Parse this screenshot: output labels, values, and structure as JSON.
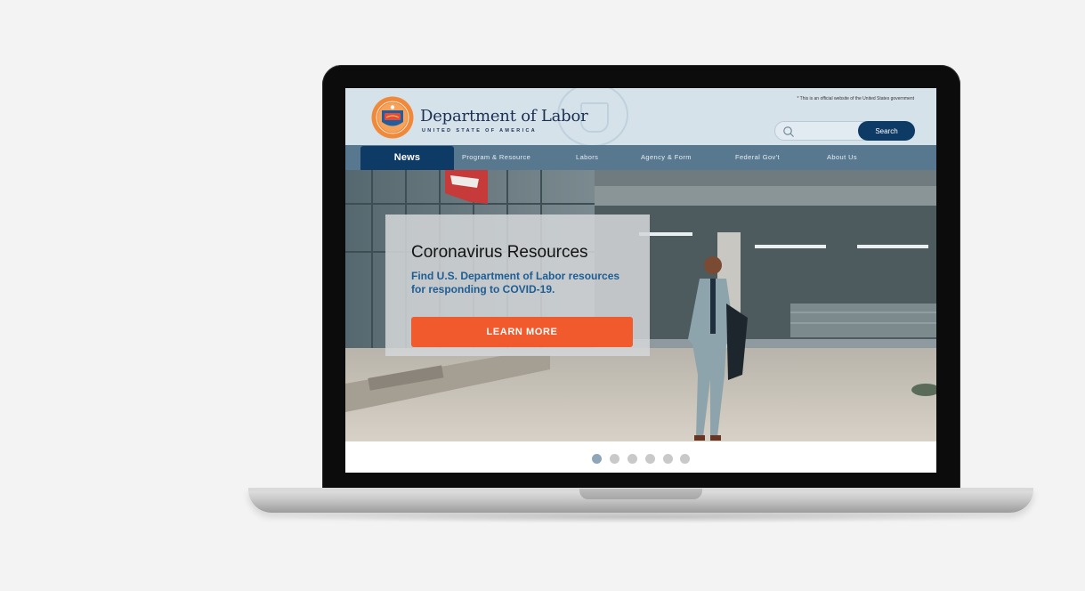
{
  "header": {
    "brand_title": "Department of Labor",
    "brand_subtitle": "UNITED STATE OF AMERICA",
    "gov_notice": "* This is an official website of the United States government",
    "search": {
      "placeholder": "",
      "value": "",
      "button_label": "Search"
    }
  },
  "nav": {
    "items": [
      {
        "label": "News",
        "active": true
      },
      {
        "label": "Program & Resource",
        "active": false
      },
      {
        "label": "Labors",
        "active": false
      },
      {
        "label": "Agency & Form",
        "active": false
      },
      {
        "label": "Federal Gov't",
        "active": false
      },
      {
        "label": "About Us",
        "active": false
      }
    ]
  },
  "hero": {
    "title": "Coronavirus Resources",
    "text": "Find U.S. Department of Labor resources for responding to COVID-19.",
    "button_label": "LEARN MORE"
  },
  "carousel": {
    "slide_count": 6,
    "active_index": 0
  },
  "colors": {
    "header_bg": "#d6e2ea",
    "nav_bg": "#58788f",
    "nav_active": "#0e3a66",
    "accent_button": "#f05a2d",
    "hero_text": "#1e5d94"
  }
}
